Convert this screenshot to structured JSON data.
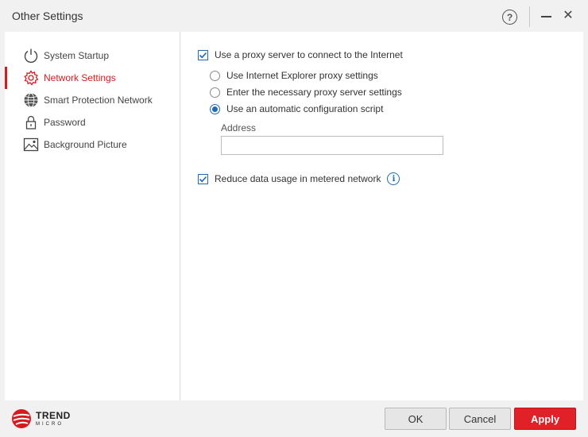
{
  "window": {
    "title": "Other Settings",
    "help_icon": "question-circle-icon",
    "minimize_icon": "minimize-icon",
    "close_icon": "close-icon",
    "help_glyph": "?",
    "close_glyph": "✕"
  },
  "sidebar": {
    "items": [
      {
        "label": "System Startup",
        "icon": "power-icon",
        "active": false
      },
      {
        "label": "Network Settings",
        "icon": "gear-icon",
        "active": true
      },
      {
        "label": "Smart Protection Network",
        "icon": "globe-icon",
        "active": false
      },
      {
        "label": "Password",
        "icon": "lock-icon",
        "active": false
      },
      {
        "label": "Background Picture",
        "icon": "picture-icon",
        "active": false
      }
    ]
  },
  "network": {
    "proxy_checkbox": {
      "label": "Use a proxy server to connect to the Internet",
      "checked": true
    },
    "proxy_options": [
      {
        "label": "Use Internet Explorer proxy settings",
        "selected": false
      },
      {
        "label": "Enter the necessary proxy server settings",
        "selected": false
      },
      {
        "label": "Use an automatic configuration script",
        "selected": true
      }
    ],
    "address_label": "Address",
    "address_value": "",
    "metered_checkbox": {
      "label": "Reduce data usage in metered network",
      "checked": true
    },
    "info_icon": "info-icon",
    "info_glyph": "i"
  },
  "footer": {
    "logo_line1": "TREND",
    "logo_line2": "MICRO",
    "ok_label": "OK",
    "cancel_label": "Cancel",
    "apply_label": "Apply"
  },
  "colors": {
    "accent_red": "#d71920",
    "accent_blue": "#1e6bb8",
    "apply_bg": "#e02128"
  }
}
